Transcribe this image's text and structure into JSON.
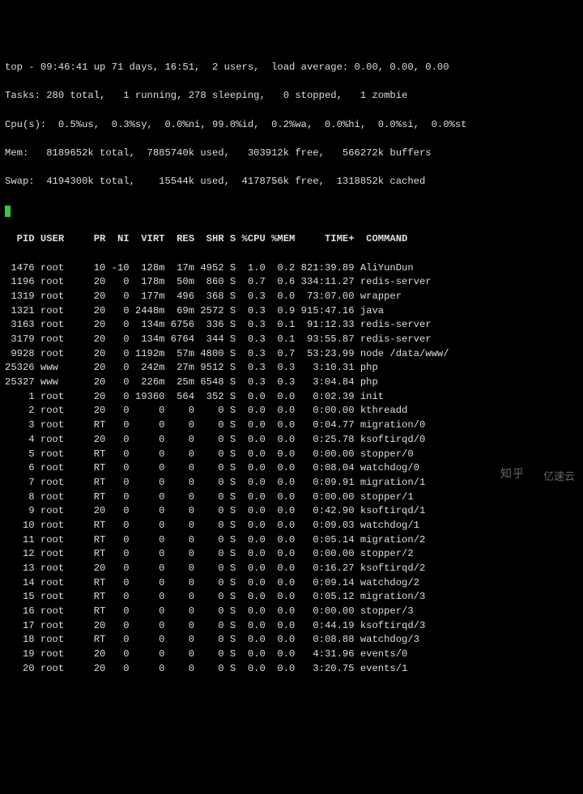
{
  "summary": {
    "line1": "top - 09:46:41 up 71 days, 16:51,  2 users,  load average: 0.00, 0.00, 0.00",
    "line2": "Tasks: 280 total,   1 running, 278 sleeping,   0 stopped,   1 zombie",
    "line3": "Cpu(s):  0.5%us,  0.3%sy,  0.0%ni, 99.0%id,  0.2%wa,  0.0%hi,  0.0%si,  0.0%st",
    "line4": "Mem:   8189652k total,  7885740k used,   303912k free,   566272k buffers",
    "line5": "Swap:  4194300k total,    15544k used,  4178756k free,  1318852k cached"
  },
  "header": {
    "pid": "PID",
    "user": "USER",
    "pr": "PR",
    "ni": "NI",
    "virt": "VIRT",
    "res": "RES",
    "shr": "SHR",
    "s": "S",
    "cpu": "%CPU",
    "mem": "%MEM",
    "time": "TIME+",
    "cmd": "COMMAND"
  },
  "rows": [
    {
      "pid": "1476",
      "user": "root",
      "pr": "10",
      "ni": "-10",
      "virt": "128m",
      "res": "17m",
      "shr": "4952",
      "s": "S",
      "cpu": "1.0",
      "mem": "0.2",
      "time": "821:39.89",
      "cmd": "AliYunDun"
    },
    {
      "pid": "1196",
      "user": "root",
      "pr": "20",
      "ni": "0",
      "virt": "178m",
      "res": "50m",
      "shr": "860",
      "s": "S",
      "cpu": "0.7",
      "mem": "0.6",
      "time": "334:11.27",
      "cmd": "redis-server"
    },
    {
      "pid": "1319",
      "user": "root",
      "pr": "20",
      "ni": "0",
      "virt": "177m",
      "res": "496",
      "shr": "368",
      "s": "S",
      "cpu": "0.3",
      "mem": "0.0",
      "time": "73:07.00",
      "cmd": "wrapper"
    },
    {
      "pid": "1321",
      "user": "root",
      "pr": "20",
      "ni": "0",
      "virt": "2448m",
      "res": "69m",
      "shr": "2572",
      "s": "S",
      "cpu": "0.3",
      "mem": "0.9",
      "time": "915:47.16",
      "cmd": "java"
    },
    {
      "pid": "3163",
      "user": "root",
      "pr": "20",
      "ni": "0",
      "virt": "134m",
      "res": "6756",
      "shr": "336",
      "s": "S",
      "cpu": "0.3",
      "mem": "0.1",
      "time": "91:12.33",
      "cmd": "redis-server"
    },
    {
      "pid": "3179",
      "user": "root",
      "pr": "20",
      "ni": "0",
      "virt": "134m",
      "res": "6764",
      "shr": "344",
      "s": "S",
      "cpu": "0.3",
      "mem": "0.1",
      "time": "93:55.87",
      "cmd": "redis-server"
    },
    {
      "pid": "9928",
      "user": "root",
      "pr": "20",
      "ni": "0",
      "virt": "1192m",
      "res": "57m",
      "shr": "4800",
      "s": "S",
      "cpu": "0.3",
      "mem": "0.7",
      "time": "53:23.99",
      "cmd": "node /data/www/"
    },
    {
      "pid": "25326",
      "user": "www",
      "pr": "20",
      "ni": "0",
      "virt": "242m",
      "res": "27m",
      "shr": "9512",
      "s": "S",
      "cpu": "0.3",
      "mem": "0.3",
      "time": "3:10.31",
      "cmd": "php"
    },
    {
      "pid": "25327",
      "user": "www",
      "pr": "20",
      "ni": "0",
      "virt": "226m",
      "res": "25m",
      "shr": "6548",
      "s": "S",
      "cpu": "0.3",
      "mem": "0.3",
      "time": "3:04.84",
      "cmd": "php"
    },
    {
      "pid": "1",
      "user": "root",
      "pr": "20",
      "ni": "0",
      "virt": "19360",
      "res": "564",
      "shr": "352",
      "s": "S",
      "cpu": "0.0",
      "mem": "0.0",
      "time": "0:02.39",
      "cmd": "init"
    },
    {
      "pid": "2",
      "user": "root",
      "pr": "20",
      "ni": "0",
      "virt": "0",
      "res": "0",
      "shr": "0",
      "s": "S",
      "cpu": "0.0",
      "mem": "0.0",
      "time": "0:00.00",
      "cmd": "kthreadd"
    },
    {
      "pid": "3",
      "user": "root",
      "pr": "RT",
      "ni": "0",
      "virt": "0",
      "res": "0",
      "shr": "0",
      "s": "S",
      "cpu": "0.0",
      "mem": "0.0",
      "time": "0:04.77",
      "cmd": "migration/0"
    },
    {
      "pid": "4",
      "user": "root",
      "pr": "20",
      "ni": "0",
      "virt": "0",
      "res": "0",
      "shr": "0",
      "s": "S",
      "cpu": "0.0",
      "mem": "0.0",
      "time": "0:25.78",
      "cmd": "ksoftirqd/0"
    },
    {
      "pid": "5",
      "user": "root",
      "pr": "RT",
      "ni": "0",
      "virt": "0",
      "res": "0",
      "shr": "0",
      "s": "S",
      "cpu": "0.0",
      "mem": "0.0",
      "time": "0:00.00",
      "cmd": "stopper/0"
    },
    {
      "pid": "6",
      "user": "root",
      "pr": "RT",
      "ni": "0",
      "virt": "0",
      "res": "0",
      "shr": "0",
      "s": "S",
      "cpu": "0.0",
      "mem": "0.0",
      "time": "0:08.04",
      "cmd": "watchdog/0"
    },
    {
      "pid": "7",
      "user": "root",
      "pr": "RT",
      "ni": "0",
      "virt": "0",
      "res": "0",
      "shr": "0",
      "s": "S",
      "cpu": "0.0",
      "mem": "0.0",
      "time": "0:09.91",
      "cmd": "migration/1"
    },
    {
      "pid": "8",
      "user": "root",
      "pr": "RT",
      "ni": "0",
      "virt": "0",
      "res": "0",
      "shr": "0",
      "s": "S",
      "cpu": "0.0",
      "mem": "0.0",
      "time": "0:00.00",
      "cmd": "stopper/1"
    },
    {
      "pid": "9",
      "user": "root",
      "pr": "20",
      "ni": "0",
      "virt": "0",
      "res": "0",
      "shr": "0",
      "s": "S",
      "cpu": "0.0",
      "mem": "0.0",
      "time": "0:42.90",
      "cmd": "ksoftirqd/1"
    },
    {
      "pid": "10",
      "user": "root",
      "pr": "RT",
      "ni": "0",
      "virt": "0",
      "res": "0",
      "shr": "0",
      "s": "S",
      "cpu": "0.0",
      "mem": "0.0",
      "time": "0:09.03",
      "cmd": "watchdog/1"
    },
    {
      "pid": "11",
      "user": "root",
      "pr": "RT",
      "ni": "0",
      "virt": "0",
      "res": "0",
      "shr": "0",
      "s": "S",
      "cpu": "0.0",
      "mem": "0.0",
      "time": "0:05.14",
      "cmd": "migration/2"
    },
    {
      "pid": "12",
      "user": "root",
      "pr": "RT",
      "ni": "0",
      "virt": "0",
      "res": "0",
      "shr": "0",
      "s": "S",
      "cpu": "0.0",
      "mem": "0.0",
      "time": "0:00.00",
      "cmd": "stopper/2"
    },
    {
      "pid": "13",
      "user": "root",
      "pr": "20",
      "ni": "0",
      "virt": "0",
      "res": "0",
      "shr": "0",
      "s": "S",
      "cpu": "0.0",
      "mem": "0.0",
      "time": "0:16.27",
      "cmd": "ksoftirqd/2"
    },
    {
      "pid": "14",
      "user": "root",
      "pr": "RT",
      "ni": "0",
      "virt": "0",
      "res": "0",
      "shr": "0",
      "s": "S",
      "cpu": "0.0",
      "mem": "0.0",
      "time": "0:09.14",
      "cmd": "watchdog/2"
    },
    {
      "pid": "15",
      "user": "root",
      "pr": "RT",
      "ni": "0",
      "virt": "0",
      "res": "0",
      "shr": "0",
      "s": "S",
      "cpu": "0.0",
      "mem": "0.0",
      "time": "0:05.12",
      "cmd": "migration/3"
    },
    {
      "pid": "16",
      "user": "root",
      "pr": "RT",
      "ni": "0",
      "virt": "0",
      "res": "0",
      "shr": "0",
      "s": "S",
      "cpu": "0.0",
      "mem": "0.0",
      "time": "0:00.00",
      "cmd": "stopper/3"
    },
    {
      "pid": "17",
      "user": "root",
      "pr": "20",
      "ni": "0",
      "virt": "0",
      "res": "0",
      "shr": "0",
      "s": "S",
      "cpu": "0.0",
      "mem": "0.0",
      "time": "0:44.19",
      "cmd": "ksoftirqd/3"
    },
    {
      "pid": "18",
      "user": "root",
      "pr": "RT",
      "ni": "0",
      "virt": "0",
      "res": "0",
      "shr": "0",
      "s": "S",
      "cpu": "0.0",
      "mem": "0.0",
      "time": "0:08.88",
      "cmd": "watchdog/3"
    },
    {
      "pid": "19",
      "user": "root",
      "pr": "20",
      "ni": "0",
      "virt": "0",
      "res": "0",
      "shr": "0",
      "s": "S",
      "cpu": "0.0",
      "mem": "0.0",
      "time": "4:31.96",
      "cmd": "events/0"
    },
    {
      "pid": "20",
      "user": "root",
      "pr": "20",
      "ni": "0",
      "virt": "0",
      "res": "0",
      "shr": "0",
      "s": "S",
      "cpu": "0.0",
      "mem": "0.0",
      "time": "3:20.75",
      "cmd": "events/1"
    }
  ],
  "watermark1": "知乎",
  "watermark2": "亿速云"
}
